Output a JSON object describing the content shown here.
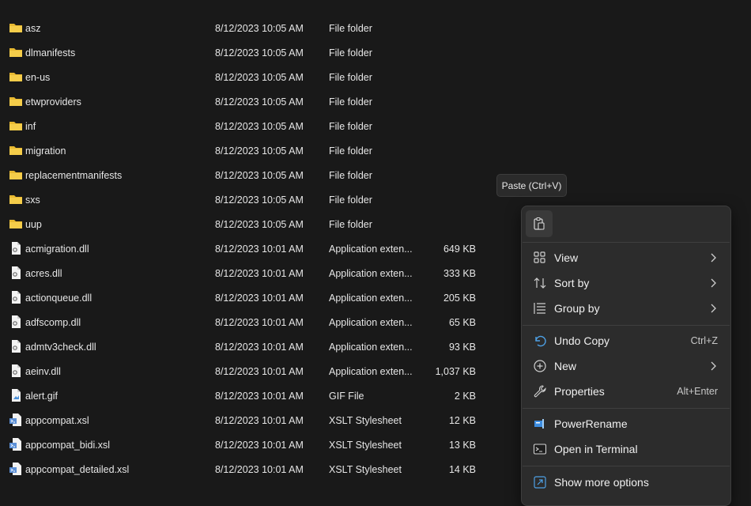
{
  "files": [
    {
      "name": "asz",
      "date": "8/12/2023 10:05 AM",
      "type": "File folder",
      "size": "",
      "icon": "folder-icon"
    },
    {
      "name": "dlmanifests",
      "date": "8/12/2023 10:05 AM",
      "type": "File folder",
      "size": "",
      "icon": "folder-icon"
    },
    {
      "name": "en-us",
      "date": "8/12/2023 10:05 AM",
      "type": "File folder",
      "size": "",
      "icon": "folder-icon"
    },
    {
      "name": "etwproviders",
      "date": "8/12/2023 10:05 AM",
      "type": "File folder",
      "size": "",
      "icon": "folder-icon"
    },
    {
      "name": "inf",
      "date": "8/12/2023 10:05 AM",
      "type": "File folder",
      "size": "",
      "icon": "folder-icon"
    },
    {
      "name": "migration",
      "date": "8/12/2023 10:05 AM",
      "type": "File folder",
      "size": "",
      "icon": "folder-icon"
    },
    {
      "name": "replacementmanifests",
      "date": "8/12/2023 10:05 AM",
      "type": "File folder",
      "size": "",
      "icon": "folder-icon"
    },
    {
      "name": "sxs",
      "date": "8/12/2023 10:05 AM",
      "type": "File folder",
      "size": "",
      "icon": "folder-icon"
    },
    {
      "name": "uup",
      "date": "8/12/2023 10:05 AM",
      "type": "File folder",
      "size": "",
      "icon": "folder-icon"
    },
    {
      "name": "acmigration.dll",
      "date": "8/12/2023 10:01 AM",
      "type": "Application exten...",
      "size": "649 KB",
      "icon": "dll-file-icon"
    },
    {
      "name": "acres.dll",
      "date": "8/12/2023 10:01 AM",
      "type": "Application exten...",
      "size": "333 KB",
      "icon": "dll-file-icon"
    },
    {
      "name": "actionqueue.dll",
      "date": "8/12/2023 10:01 AM",
      "type": "Application exten...",
      "size": "205 KB",
      "icon": "dll-file-icon"
    },
    {
      "name": "adfscomp.dll",
      "date": "8/12/2023 10:01 AM",
      "type": "Application exten...",
      "size": "65 KB",
      "icon": "dll-file-icon"
    },
    {
      "name": "admtv3check.dll",
      "date": "8/12/2023 10:01 AM",
      "type": "Application exten...",
      "size": "93 KB",
      "icon": "dll-file-icon"
    },
    {
      "name": "aeinv.dll",
      "date": "8/12/2023 10:01 AM",
      "type": "Application exten...",
      "size": "1,037 KB",
      "icon": "dll-file-icon"
    },
    {
      "name": "alert.gif",
      "date": "8/12/2023 10:01 AM",
      "type": "GIF File",
      "size": "2 KB",
      "icon": "image-file-icon"
    },
    {
      "name": "appcompat.xsl",
      "date": "8/12/2023 10:01 AM",
      "type": "XSLT Stylesheet",
      "size": "12 KB",
      "icon": "xsl-file-icon"
    },
    {
      "name": "appcompat_bidi.xsl",
      "date": "8/12/2023 10:01 AM",
      "type": "XSLT Stylesheet",
      "size": "13 KB",
      "icon": "xsl-file-icon"
    },
    {
      "name": "appcompat_detailed.xsl",
      "date": "8/12/2023 10:01 AM",
      "type": "XSLT Stylesheet",
      "size": "14 KB",
      "icon": "xsl-file-icon"
    }
  ],
  "tooltip": {
    "text": "Paste (Ctrl+V)"
  },
  "context_menu": {
    "quick_action_icon": "paste-icon",
    "items": [
      {
        "label": "View",
        "shortcut": "",
        "submenu": true,
        "icon": "view-grid-icon"
      },
      {
        "label": "Sort by",
        "shortcut": "",
        "submenu": true,
        "icon": "sort-icon"
      },
      {
        "label": "Group by",
        "shortcut": "",
        "submenu": true,
        "icon": "group-icon"
      },
      {
        "label": "Undo Copy",
        "shortcut": "Ctrl+Z",
        "submenu": false,
        "icon": "undo-icon"
      },
      {
        "label": "New",
        "shortcut": "",
        "submenu": true,
        "icon": "new-plus-icon"
      },
      {
        "label": "Properties",
        "shortcut": "Alt+Enter",
        "submenu": false,
        "icon": "properties-wrench-icon"
      },
      {
        "label": "PowerRename",
        "shortcut": "",
        "submenu": false,
        "icon": "powerrename-icon"
      },
      {
        "label": "Open in Terminal",
        "shortcut": "",
        "submenu": false,
        "icon": "terminal-icon"
      },
      {
        "label": "Show more options",
        "shortcut": "",
        "submenu": false,
        "icon": "show-more-icon"
      }
    ]
  },
  "colors": {
    "folder": "#e8b931",
    "accent": "#4ea1e6",
    "background": "#191919",
    "menu": "#2c2c2c"
  }
}
